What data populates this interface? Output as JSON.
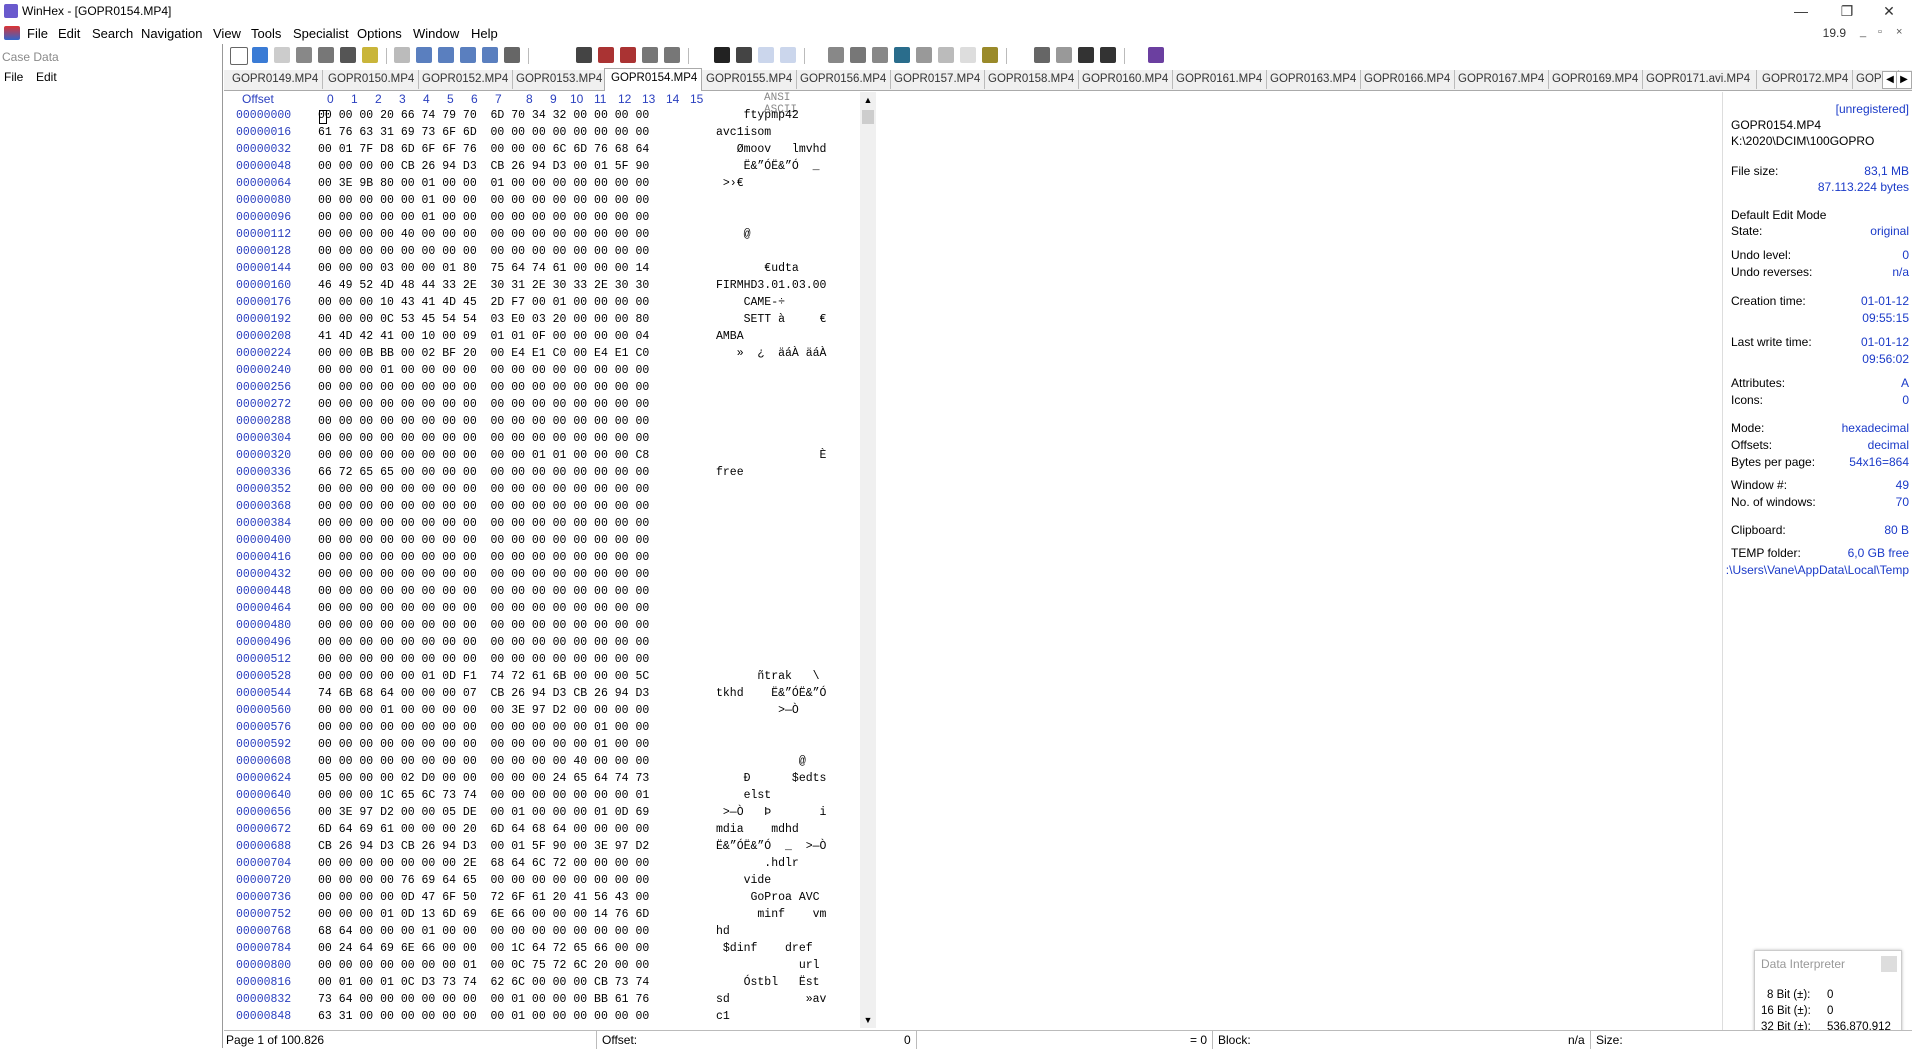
{
  "window": {
    "title": "WinHex - [GOPR0154.MP4]",
    "minimize": "—",
    "restore": "❐",
    "close": "✕"
  },
  "menu": {
    "items": [
      "File",
      "Edit",
      "Search",
      "Navigation",
      "View",
      "Tools",
      "Specialist",
      "Options",
      "Window",
      "Help"
    ],
    "version": "19.9",
    "mdi": [
      "_",
      "▫",
      "×"
    ]
  },
  "left_panel": {
    "title": "Case Data",
    "menu_file": "File",
    "menu_edit": "Edit"
  },
  "tabs": [
    "GOPR0149.MP4",
    "GOPR0150.MP4",
    "GOPR0152.MP4",
    "GOPR0153.MP4",
    "GOPR0154.MP4",
    "GOPR0155.MP4",
    "GOPR0156.MP4",
    "GOPR0157.MP4",
    "GOPR0158.MP4",
    "GOPR0160.MP4",
    "GOPR0161.MP4",
    "GOPR0163.MP4",
    "GOPR0166.MP4",
    "GOPR0167.MP4",
    "GOPR0169.MP4",
    "GOPR0171.avi.MP4",
    "GOPR0172.MP4",
    "GOPRO"
  ],
  "active_tab": "GOPR0154.MP4",
  "hex_header": {
    "offset": "Offset",
    "columns": [
      "0",
      "1",
      "2",
      "3",
      "4",
      "5",
      "6",
      "7",
      "8",
      "9",
      "10",
      "11",
      "12",
      "13",
      "14",
      "15"
    ],
    "ansi": "ANSI ASCII"
  },
  "rows": [
    {
      "off": "00000000",
      "hex": "00 00 00 20 66 74 79 70  6D 70 34 32 00 00 00 00",
      "asc": "    ftypmp42"
    },
    {
      "off": "00000016",
      "hex": "61 76 63 31 69 73 6F 6D  00 00 00 00 00 00 00 00",
      "asc": "avc1isom"
    },
    {
      "off": "00000032",
      "hex": "00 01 7F D8 6D 6F 6F 76  00 00 00 6C 6D 76 68 64",
      "asc": "   Ømoov   lmvhd"
    },
    {
      "off": "00000048",
      "hex": "00 00 00 00 CB 26 94 D3  CB 26 94 D3 00 01 5F 90",
      "asc": "    Ë&”ÓË&”Ó  _"
    },
    {
      "off": "00000064",
      "hex": "00 3E 9B 80 00 01 00 00  01 00 00 00 00 00 00 00",
      "asc": " >›€"
    },
    {
      "off": "00000080",
      "hex": "00 00 00 00 00 01 00 00  00 00 00 00 00 00 00 00",
      "asc": ""
    },
    {
      "off": "00000096",
      "hex": "00 00 00 00 00 01 00 00  00 00 00 00 00 00 00 00",
      "asc": ""
    },
    {
      "off": "00000112",
      "hex": "00 00 00 00 40 00 00 00  00 00 00 00 00 00 00 00",
      "asc": "    @"
    },
    {
      "off": "00000128",
      "hex": "00 00 00 00 00 00 00 00  00 00 00 00 00 00 00 00",
      "asc": ""
    },
    {
      "off": "00000144",
      "hex": "00 00 00 03 00 00 01 80  75 64 74 61 00 00 00 14",
      "asc": "       €udta"
    },
    {
      "off": "00000160",
      "hex": "46 49 52 4D 48 44 33 2E  30 31 2E 30 33 2E 30 30",
      "asc": "FIRMHD3.01.03.00"
    },
    {
      "off": "00000176",
      "hex": "00 00 00 10 43 41 4D 45  2D F7 00 01 00 00 00 00",
      "asc": "    CAME-÷"
    },
    {
      "off": "00000192",
      "hex": "00 00 00 0C 53 45 54 54  03 E0 03 20 00 00 00 80",
      "asc": "    SETT à     €"
    },
    {
      "off": "00000208",
      "hex": "41 4D 42 41 00 10 00 09  01 01 0F 00 00 00 00 04",
      "asc": "AMBA"
    },
    {
      "off": "00000224",
      "hex": "00 00 0B BB 00 02 BF 20  00 E4 E1 C0 00 E4 E1 C0",
      "asc": "   »  ¿  äáÀ äáÀ"
    },
    {
      "off": "00000240",
      "hex": "00 00 00 01 00 00 00 00  00 00 00 00 00 00 00 00",
      "asc": ""
    },
    {
      "off": "00000256",
      "hex": "00 00 00 00 00 00 00 00  00 00 00 00 00 00 00 00",
      "asc": ""
    },
    {
      "off": "00000272",
      "hex": "00 00 00 00 00 00 00 00  00 00 00 00 00 00 00 00",
      "asc": ""
    },
    {
      "off": "00000288",
      "hex": "00 00 00 00 00 00 00 00  00 00 00 00 00 00 00 00",
      "asc": ""
    },
    {
      "off": "00000304",
      "hex": "00 00 00 00 00 00 00 00  00 00 00 00 00 00 00 00",
      "asc": ""
    },
    {
      "off": "00000320",
      "hex": "00 00 00 00 00 00 00 00  00 00 01 01 00 00 00 C8",
      "asc": "               È"
    },
    {
      "off": "00000336",
      "hex": "66 72 65 65 00 00 00 00  00 00 00 00 00 00 00 00",
      "asc": "free"
    },
    {
      "off": "00000352",
      "hex": "00 00 00 00 00 00 00 00  00 00 00 00 00 00 00 00",
      "asc": ""
    },
    {
      "off": "00000368",
      "hex": "00 00 00 00 00 00 00 00  00 00 00 00 00 00 00 00",
      "asc": ""
    },
    {
      "off": "00000384",
      "hex": "00 00 00 00 00 00 00 00  00 00 00 00 00 00 00 00",
      "asc": ""
    },
    {
      "off": "00000400",
      "hex": "00 00 00 00 00 00 00 00  00 00 00 00 00 00 00 00",
      "asc": ""
    },
    {
      "off": "00000416",
      "hex": "00 00 00 00 00 00 00 00  00 00 00 00 00 00 00 00",
      "asc": ""
    },
    {
      "off": "00000432",
      "hex": "00 00 00 00 00 00 00 00  00 00 00 00 00 00 00 00",
      "asc": ""
    },
    {
      "off": "00000448",
      "hex": "00 00 00 00 00 00 00 00  00 00 00 00 00 00 00 00",
      "asc": ""
    },
    {
      "off": "00000464",
      "hex": "00 00 00 00 00 00 00 00  00 00 00 00 00 00 00 00",
      "asc": ""
    },
    {
      "off": "00000480",
      "hex": "00 00 00 00 00 00 00 00  00 00 00 00 00 00 00 00",
      "asc": ""
    },
    {
      "off": "00000496",
      "hex": "00 00 00 00 00 00 00 00  00 00 00 00 00 00 00 00",
      "asc": ""
    },
    {
      "off": "00000512",
      "hex": "00 00 00 00 00 00 00 00  00 00 00 00 00 00 00 00",
      "asc": ""
    },
    {
      "off": "00000528",
      "hex": "00 00 00 00 00 01 0D F1  74 72 61 6B 00 00 00 5C",
      "asc": "      ñtrak   \\"
    },
    {
      "off": "00000544",
      "hex": "74 6B 68 64 00 00 00 07  CB 26 94 D3 CB 26 94 D3",
      "asc": "tkhd    Ë&”ÓË&”Ó"
    },
    {
      "off": "00000560",
      "hex": "00 00 00 01 00 00 00 00  00 3E 97 D2 00 00 00 00",
      "asc": "         >—Ò"
    },
    {
      "off": "00000576",
      "hex": "00 00 00 00 00 00 00 00  00 00 00 00 00 01 00 00",
      "asc": ""
    },
    {
      "off": "00000592",
      "hex": "00 00 00 00 00 00 00 00  00 00 00 00 00 01 00 00",
      "asc": ""
    },
    {
      "off": "00000608",
      "hex": "00 00 00 00 00 00 00 00  00 00 00 00 40 00 00 00",
      "asc": "            @"
    },
    {
      "off": "00000624",
      "hex": "05 00 00 00 02 D0 00 00  00 00 00 24 65 64 74 73",
      "asc": "    Ð      $edts"
    },
    {
      "off": "00000640",
      "hex": "00 00 00 1C 65 6C 73 74  00 00 00 00 00 00 00 01",
      "asc": "    elst"
    },
    {
      "off": "00000656",
      "hex": "00 3E 97 D2 00 00 05 DE  00 01 00 00 00 01 0D 69",
      "asc": " >—Ò   Þ       i"
    },
    {
      "off": "00000672",
      "hex": "6D 64 69 61 00 00 00 20  6D 64 68 64 00 00 00 00",
      "asc": "mdia    mdhd"
    },
    {
      "off": "00000688",
      "hex": "CB 26 94 D3 CB 26 94 D3  00 01 5F 90 00 3E 97 D2",
      "asc": "Ë&”ÓË&”Ó  _  >—Ò"
    },
    {
      "off": "00000704",
      "hex": "00 00 00 00 00 00 00 2E  68 64 6C 72 00 00 00 00",
      "asc": "       .hdlr"
    },
    {
      "off": "00000720",
      "hex": "00 00 00 00 76 69 64 65  00 00 00 00 00 00 00 00",
      "asc": "    vide"
    },
    {
      "off": "00000736",
      "hex": "00 00 00 00 0D 47 6F 50  72 6F 61 20 41 56 43 00",
      "asc": "     GoProa AVC"
    },
    {
      "off": "00000752",
      "hex": "00 00 00 01 0D 13 6D 69  6E 66 00 00 00 14 76 6D",
      "asc": "      minf    vm"
    },
    {
      "off": "00000768",
      "hex": "68 64 00 00 00 01 00 00  00 00 00 00 00 00 00 00",
      "asc": "hd"
    },
    {
      "off": "00000784",
      "hex": "00 24 64 69 6E 66 00 00  00 1C 64 72 65 66 00 00",
      "asc": " $dinf    dref"
    },
    {
      "off": "00000800",
      "hex": "00 00 00 00 00 00 00 01  00 0C 75 72 6C 20 00 00",
      "asc": "            url"
    },
    {
      "off": "00000816",
      "hex": "00 01 00 01 0C D3 73 74  62 6C 00 00 00 CB 73 74",
      "asc": "    Óstbl   Ëst"
    },
    {
      "off": "00000832",
      "hex": "73 64 00 00 00 00 00 00  00 01 00 00 00 BB 61 76",
      "asc": "sd           »av"
    },
    {
      "off": "00000848",
      "hex": "63 31 00 00 00 00 00 00  00 01 00 00 00 00 00 00",
      "asc": "c1"
    }
  ],
  "info": {
    "unregistered": "[unregistered]",
    "filename": "GOPR0154.MP4",
    "path": "K:\\2020\\DCIM\\100GOPRO",
    "file_size_label": "File size:",
    "file_size_mb": "83,1 MB",
    "file_size_bytes": "87.113.224 bytes",
    "edit_mode": "Default Edit Mode",
    "state_label": "State:",
    "state": "original",
    "undo_level_label": "Undo level:",
    "undo_level": "0",
    "undo_rev_label": "Undo reverses:",
    "undo_rev": "n/a",
    "ctime_label": "Creation time:",
    "ctime_date": "01-01-12",
    "ctime_time": "09:55:15",
    "wtime_label": "Last write time:",
    "wtime_date": "01-01-12",
    "wtime_time": "09:56:02",
    "attr_label": "Attributes:",
    "attr": "A",
    "icons_label": "Icons:",
    "icons": "0",
    "mode_label": "Mode:",
    "mode": "hexadecimal",
    "offsets_label": "Offsets:",
    "offsets": "decimal",
    "bpp_label": "Bytes per page:",
    "bpp": "54x16=864",
    "winno_label": "Window #:",
    "winno": "49",
    "nwin_label": "No. of windows:",
    "nwin": "70",
    "clip_label": "Clipboard:",
    "clip": "80 B",
    "temp_label": "TEMP folder:",
    "temp": "6,0 GB free",
    "temp_path": ":\\Users\\Vane\\AppData\\Local\\Temp"
  },
  "interpreter": {
    "title": "Data Interpreter",
    "r8_label": "8 Bit (±):",
    "r8": "0",
    "r16_label": "16 Bit (±):",
    "r16": "0",
    "r32_label": "32 Bit (±):",
    "r32": "536.870.912"
  },
  "status": {
    "page": "Page 1 of 100.826",
    "offset_label": "Offset:",
    "offset": "0",
    "eq": "= 0",
    "block_label": "Block:",
    "block": "n/a",
    "size_label": "Size:"
  }
}
